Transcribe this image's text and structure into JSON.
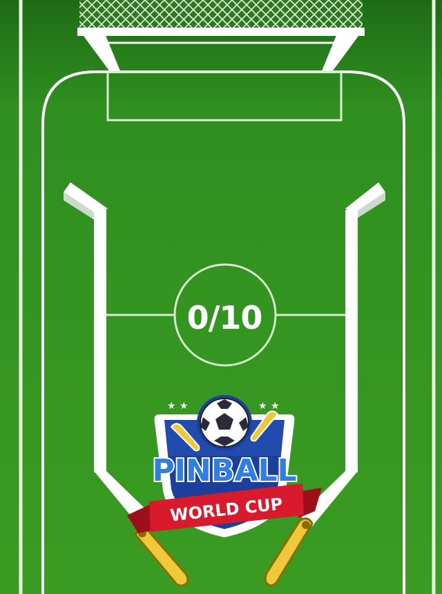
{
  "score": {
    "current": 0,
    "target": 10,
    "display": "0/10"
  },
  "logo": {
    "title": "PINBALL",
    "subtitle": "WORLD CUP"
  },
  "colors": {
    "grass": "#2f8f1f",
    "grass_dark": "#1e6b16",
    "line": "#ffffff",
    "flipper": "#f0c93a",
    "shield_blue": "#1d3f9c",
    "ribbon_red": "#d9192c",
    "title_blue": "#2f7fe0"
  },
  "icons": {
    "ball": "soccer-ball-icon",
    "stars": "star-icon"
  }
}
